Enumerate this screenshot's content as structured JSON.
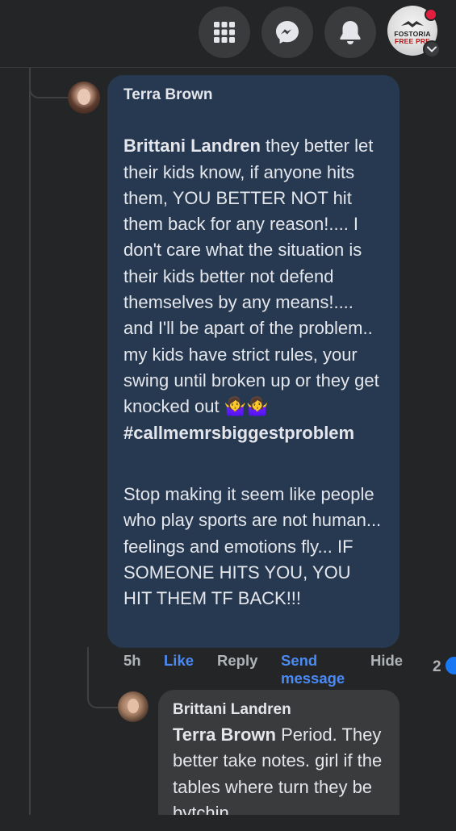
{
  "topbar": {
    "icons": [
      "menu-grid-icon",
      "messenger-icon",
      "notifications-bell-icon"
    ],
    "profile_logo": {
      "line1": "FOSTORIA",
      "line2": "FREE PRE"
    }
  },
  "comments": [
    {
      "author": "Terra Brown",
      "mention": "Brittani Landren",
      "text_part1": " they better let their kids know, if anyone hits them, YOU BETTER NOT hit them back for any reason!.... I don't care what the situation is their kids better not defend themselves by any means!.... and I'll be apart of the problem.. my kids have strict rules, your swing until broken up or they get knocked out 🤷‍♀️🤷‍♀️",
      "hashtag": "#callmemrsbiggestproblem",
      "text_part2": "Stop making it seem like people who play sports are not human... feelings and emotions fly... IF SOMEONE HITS YOU, YOU HIT THEM TF BACK!!!",
      "actions": {
        "time": "5h",
        "like": "Like",
        "reply": "Reply",
        "send_message": "Send message",
        "hide": "Hide",
        "reaction_count": "2"
      }
    },
    {
      "author": "Brittani Landren",
      "mention": "Terra Brown",
      "text": " Period. They better take notes. girl if the tables where turn they be bytchin"
    }
  ],
  "colors": {
    "background": "#242526",
    "highlight_bubble": "#263951",
    "reply_bubble": "#3a3b3c",
    "link_blue": "#4a8af4",
    "notification_red": "#e41e3f"
  }
}
